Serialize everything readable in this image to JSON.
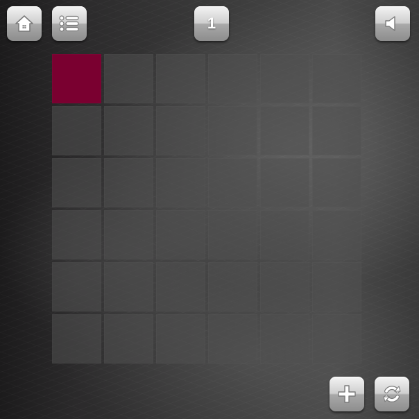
{
  "toolbar": {
    "home_icon": "home-icon",
    "menu_icon": "list-icon",
    "sound_icon": "speaker-icon",
    "level_number": "1"
  },
  "controls": {
    "add_icon": "plus-icon",
    "restart_icon": "refresh-icon"
  },
  "board": {
    "rows": 6,
    "cols": 6,
    "empty_color": "#505050",
    "active_color": "#7a0030",
    "cells": [
      [
        "active",
        "empty",
        "empty",
        "empty",
        "empty",
        "empty"
      ],
      [
        "empty",
        "empty",
        "empty",
        "empty",
        "empty",
        "empty"
      ],
      [
        "empty",
        "empty",
        "empty",
        "empty",
        "empty",
        "empty"
      ],
      [
        "empty",
        "empty",
        "empty",
        "empty",
        "empty",
        "empty"
      ],
      [
        "empty",
        "empty",
        "empty",
        "empty",
        "empty",
        "empty"
      ],
      [
        "empty",
        "empty",
        "empty",
        "empty",
        "empty",
        "empty"
      ]
    ]
  }
}
